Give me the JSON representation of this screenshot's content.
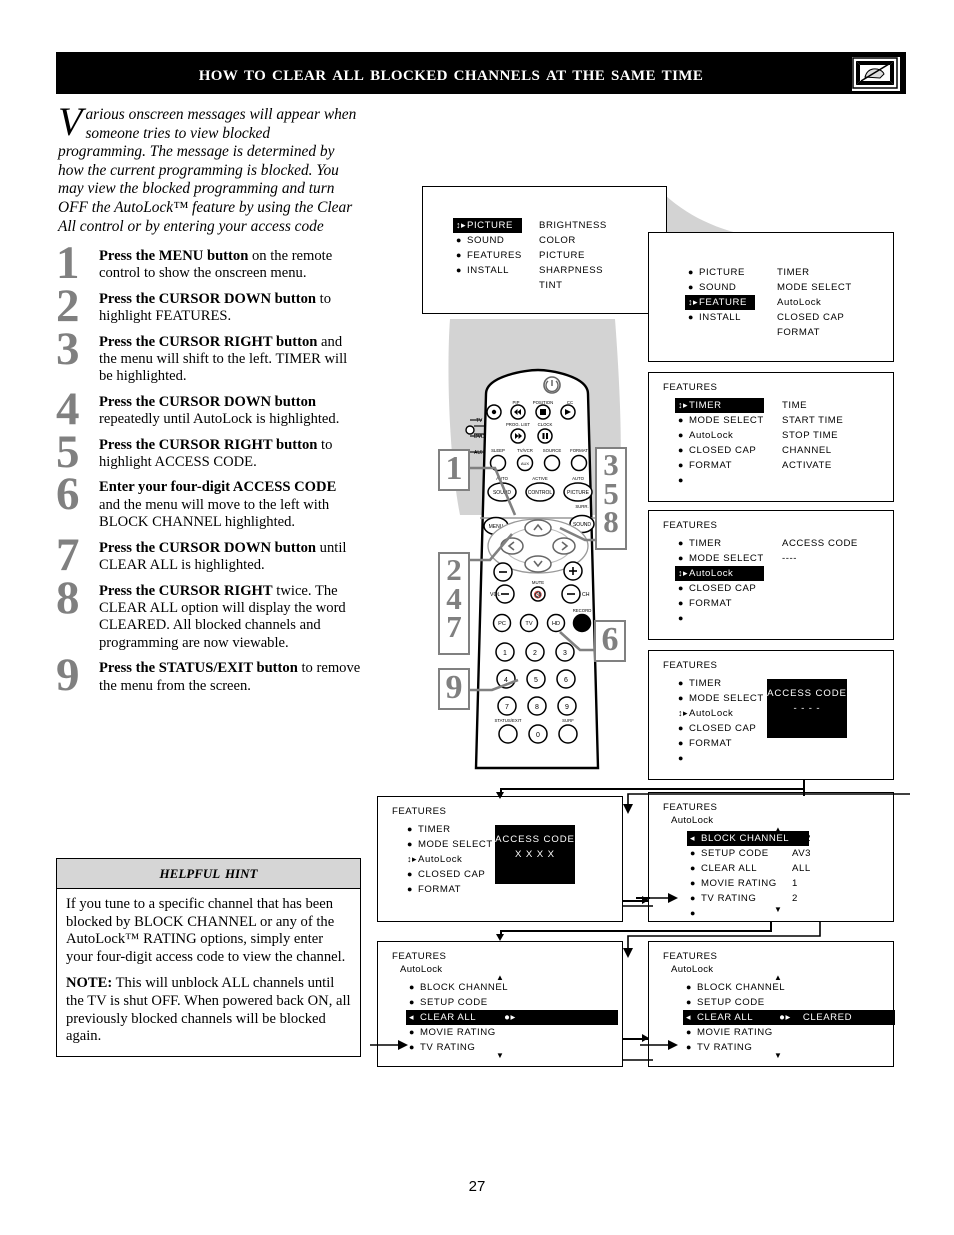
{
  "header": {
    "title": "How to Clear All Blocked Channels at the Same Time",
    "icon": "blocked-tv-icon"
  },
  "intro": {
    "dropcap": "V",
    "text": "arious onscreen messages will appear when someone tries to view blocked programming. The message is determined by how the current programming is blocked. You may view the blocked programming and turn OFF the AutoLock™ feature by using the Clear All control or by entering your access code"
  },
  "steps": [
    {
      "num": "1",
      "bold": "Press the MENU button",
      "rest": " on the remote control to show the onscreen menu."
    },
    {
      "num": "2",
      "bold": "Press the CURSOR DOWN button",
      "rest": " to highlight FEATURES."
    },
    {
      "num": "3",
      "bold": "Press the CURSOR RIGHT button",
      "rest": " and the menu will shift to the left. TIMER will be highlighted."
    },
    {
      "num": "4",
      "bold": "Press the CURSOR DOWN button",
      "rest": " repeatedly until AutoLock is highlighted."
    },
    {
      "num": "5",
      "bold": "Press the CURSOR RIGHT button",
      "rest": " to highlight ACCESS CODE."
    },
    {
      "num": "6",
      "bold": "Enter your four-digit ACCESS CODE",
      "rest": " and the menu will move to the left with BLOCK CHANNEL highlighted."
    },
    {
      "num": "7",
      "bold": "Press the CURSOR DOWN button",
      "rest": " until CLEAR ALL is highlighted."
    },
    {
      "num": "8",
      "bold": "Press the CURSOR RIGHT",
      "rest": " twice. The CLEAR ALL option will display the word CLEARED. All blocked channels and programming are now viewable."
    },
    {
      "num": "9",
      "bold": "Press the STATUS/EXIT button",
      "rest": " to remove the menu from the screen."
    }
  ],
  "hint": {
    "heading": "Helpful Hint",
    "para1": "If you tune to a specific channel that has been blocked by BLOCK CHANNEL or any of the AutoLock™ RATING options, simply enter your four-digit access code to view the channel.",
    "note_label": "NOTE:",
    "para2": " This will unblock ALL channels until the TV is shut OFF. When powered back ON, all previously blocked channels will be blocked again."
  },
  "menus": {
    "m1": {
      "left": [
        {
          "label": "PICTURE",
          "highlighted": true
        },
        {
          "label": "SOUND",
          "highlighted": false
        },
        {
          "label": "FEATURES",
          "highlighted": false
        },
        {
          "label": "INSTALL",
          "highlighted": false
        }
      ],
      "right": [
        "BRIGHTNESS",
        "COLOR",
        "PICTURE",
        "SHARPNESS",
        "TINT"
      ]
    },
    "m2": {
      "left": [
        {
          "label": "PICTURE",
          "highlighted": false
        },
        {
          "label": "SOUND",
          "highlighted": false
        },
        {
          "label": "FEATURE",
          "highlighted": true
        },
        {
          "label": "INSTALL",
          "highlighted": false
        }
      ],
      "right": [
        "TIMER",
        "MODE SELECT",
        "AutoLock",
        "CLOSED CAP",
        "FORMAT"
      ]
    },
    "m3": {
      "title": "FEATURES",
      "left": [
        {
          "label": "TIMER",
          "highlighted": true
        },
        {
          "label": "MODE SELECT",
          "highlighted": false
        },
        {
          "label": "AutoLock",
          "highlighted": false
        },
        {
          "label": "CLOSED CAP",
          "highlighted": false
        },
        {
          "label": "FORMAT",
          "highlighted": false
        },
        {
          "label": "",
          "highlighted": false
        }
      ],
      "right": [
        "TIME",
        "START TIME",
        "STOP TIME",
        "CHANNEL",
        "ACTIVATE"
      ]
    },
    "m4": {
      "title": "FEATURES",
      "left": [
        {
          "label": "TIMER",
          "highlighted": false
        },
        {
          "label": "MODE SELECT",
          "highlighted": false
        },
        {
          "label": "AutoLock",
          "highlighted": true
        },
        {
          "label": "CLOSED CAP",
          "highlighted": false
        },
        {
          "label": "FORMAT",
          "highlighted": false
        },
        {
          "label": "",
          "highlighted": false
        }
      ],
      "right": [
        "ACCESS CODE",
        "----"
      ]
    },
    "m5": {
      "title": "FEATURES",
      "left": [
        {
          "label": "TIMER",
          "highlighted": false
        },
        {
          "label": "MODE SELECT",
          "highlighted": false
        },
        {
          "label": "AutoLock",
          "highlighted": false
        },
        {
          "label": "CLOSED CAP",
          "highlighted": false
        },
        {
          "label": "FORMAT",
          "highlighted": false
        },
        {
          "label": "",
          "highlighted": false
        }
      ],
      "popup_title": "ACCESS CODE",
      "popup_value": "- - - -"
    },
    "m6": {
      "title": "FEATURES",
      "left": [
        {
          "label": "TIMER",
          "highlighted": false
        },
        {
          "label": "MODE SELECT",
          "highlighted": false
        },
        {
          "label": "AutoLock",
          "highlighted": false
        },
        {
          "label": "CLOSED CAP",
          "highlighted": false
        },
        {
          "label": "FORMAT",
          "highlighted": false
        }
      ],
      "popup_title": "ACCESS CODE",
      "popup_value": "X X X X"
    },
    "m7": {
      "title": "FEATURES",
      "subtitle": "AutoLock",
      "left": [
        {
          "label": "BLOCK CHANNEL",
          "highlighted": true
        },
        {
          "label": "SETUP CODE",
          "highlighted": false
        },
        {
          "label": "CLEAR ALL",
          "highlighted": false
        },
        {
          "label": "MOVIE RATING",
          "highlighted": false
        },
        {
          "label": "TV RATING",
          "highlighted": false
        },
        {
          "label": "",
          "highlighted": false
        }
      ],
      "right": [
        "AV2",
        "AV3",
        "ALL",
        "1",
        "2"
      ]
    },
    "m8": {
      "title": "FEATURES",
      "subtitle": "AutoLock",
      "left": [
        {
          "label": "BLOCK CHANNEL",
          "highlighted": false
        },
        {
          "label": "SETUP CODE",
          "highlighted": false
        },
        {
          "label": "CLEAR ALL",
          "highlighted": true
        },
        {
          "label": "MOVIE RATING",
          "highlighted": false
        },
        {
          "label": "TV RATING",
          "highlighted": false
        }
      ],
      "value": ""
    },
    "m9": {
      "title": "FEATURES",
      "subtitle": "AutoLock",
      "left": [
        {
          "label": "BLOCK CHANNEL",
          "highlighted": false
        },
        {
          "label": "SETUP CODE",
          "highlighted": false
        },
        {
          "label": "CLEAR ALL",
          "highlighted": true
        },
        {
          "label": "MOVIE RATING",
          "highlighted": false
        },
        {
          "label": "TV RATING",
          "highlighted": false
        }
      ],
      "value": "CLEARED"
    }
  },
  "callouts": {
    "c1": "1",
    "c2": [
      "2",
      "4",
      "7"
    ],
    "c3": [
      "3",
      "5",
      "8"
    ],
    "c6": "6",
    "c9": "9"
  },
  "remote": {
    "side_labels": [
      "TV",
      "DVD",
      "AUX"
    ],
    "row1_top": [
      "PIP",
      "POSITION",
      "CC"
    ],
    "row2_top": [
      "PROG. LIST",
      "CLOCK"
    ],
    "row3": [
      "SLEEP",
      "TV/VCR",
      "SOURCE",
      "FORMAT"
    ],
    "row3_small": [
      "AUX"
    ],
    "row4_top": [
      "AUTO",
      "ACTIVE",
      "AUTO"
    ],
    "row4": [
      "SOUND",
      "CONTROL",
      "PICTURE"
    ],
    "menu_btn": "MENU",
    "surround_btn": "SOUND",
    "surround_label": "SURR.",
    "vol_label": "VOL",
    "ch_label": "CH",
    "mute_label": "MUTE",
    "src_row": [
      "PC",
      "TV",
      "HD",
      "▣"
    ],
    "src_row_label": "RECORD",
    "keys": [
      "1",
      "2",
      "3",
      "4",
      "5",
      "6",
      "7",
      "8",
      "9",
      "0"
    ],
    "status_label": "STATUS/EXIT",
    "surf_label": "SURF"
  },
  "page_number": "27",
  "colors": {
    "accent_gray": "#808080",
    "hint_header": "#d6d6d6",
    "beam_gray": "#d3d3d3",
    "black": "#000000"
  }
}
